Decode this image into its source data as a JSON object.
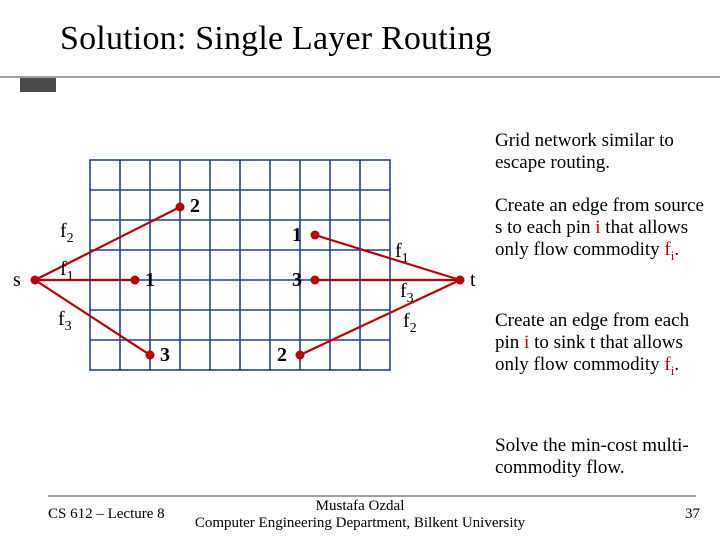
{
  "title": "Solution: Single Layer Routing",
  "captions": {
    "grid": "Grid network similar to escape routing.",
    "source_a": "Create an edge from source s to each pin ",
    "source_i": "i",
    "source_b": " that allows only flow commodity ",
    "source_c": "f",
    "source_d_sub": "i",
    "source_e": ".",
    "sink_a": "Create an edge from each pin ",
    "sink_i": "i",
    "sink_b": " to sink t that allows only flow commodity ",
    "sink_c": "f",
    "sink_d_sub": "i",
    "sink_e": ".",
    "solve": "Solve the min-cost multi-commodity flow."
  },
  "labels": {
    "s": "s",
    "t": "t",
    "f1_left": "f",
    "f1_left_sub": "1",
    "f2_left": "f",
    "f2_left_sub": "2",
    "f3_left": "f",
    "f3_left_sub": "3",
    "f1_right": "f",
    "f1_right_sub": "1",
    "f2_right": "f",
    "f2_right_sub": "2",
    "f3_right": "f",
    "f3_right_sub": "3",
    "pin_l1": "1",
    "pin_l2": "2",
    "pin_l3": "3",
    "pin_r1": "1",
    "pin_r2": "2",
    "pin_r3": "3"
  },
  "footer": {
    "left": "CS 612 – Lecture 8",
    "center_line1": "Mustafa Ozdal",
    "center_line2": "Computer Engineering Department, Bilkent University",
    "page": "37"
  }
}
